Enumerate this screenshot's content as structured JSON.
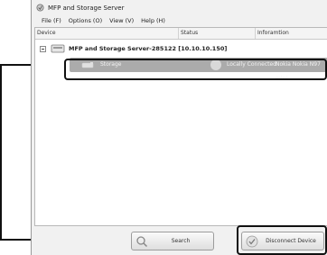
{
  "window": {
    "title": "MFP and Storage Server"
  },
  "menu": [
    {
      "label": "File (F)"
    },
    {
      "label": "Options (O)"
    },
    {
      "label": "View (V)"
    },
    {
      "label": "Help (H)"
    }
  ],
  "columns": {
    "device": "Device",
    "status": "Status",
    "information": "Inforamtion"
  },
  "server_group": {
    "label": "MFP and Storage Server-285122  [10.10.10.150]"
  },
  "device_row": {
    "name": "Storage",
    "status": "Locally Connected",
    "information": "Nokia Nokia N97 mini"
  },
  "buttons": {
    "search": "Search",
    "disconnect": "Disconnect Device"
  }
}
